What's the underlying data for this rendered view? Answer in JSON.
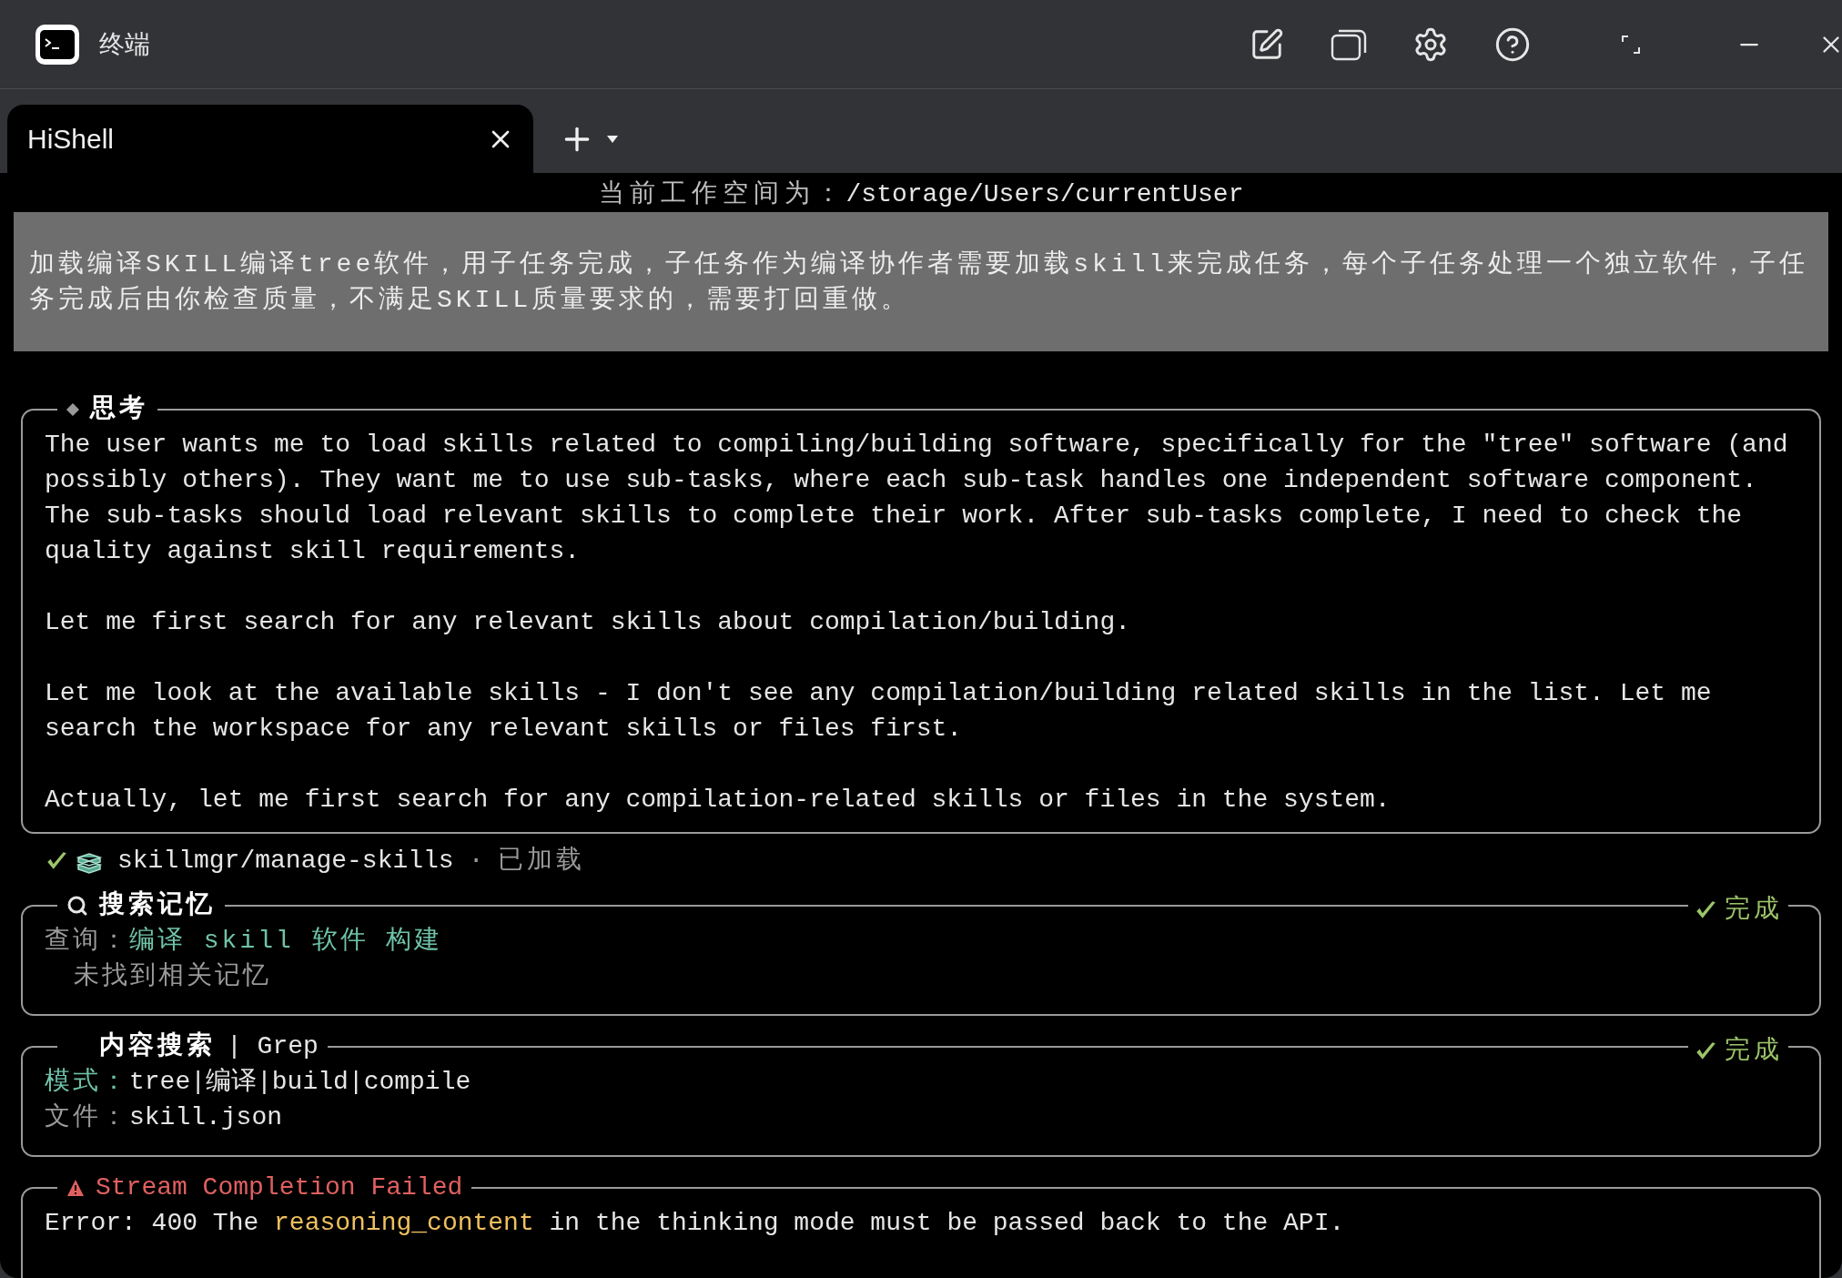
{
  "window": {
    "title": "终端"
  },
  "tabs": [
    {
      "label": "HiShell",
      "selected": true
    }
  ],
  "workspace": {
    "label": "当前工作空间为：",
    "path": "/storage/Users/currentUser"
  },
  "prompt": "加载编译SKILL编译tree软件，用子任务完成，子任务作为编译协作者需要加载skill来完成任务，每个子任务处理一个独立软件，子任务完成后由你检查质量，不满足SKILL质量要求的，需要打回重做。",
  "blocks": [
    {
      "kind": "thinking",
      "title": "思考",
      "paragraphs": [
        "The user wants me to load skills related to compiling/building software, specifically for the \"tree\" software (and\npossibly others). They want me to use sub-tasks, where each sub-task handles one independent software component.\nThe sub-tasks should load relevant skills to complete their work. After sub-tasks complete, I need to check the\nquality against skill requirements.",
        "Let me first search for any relevant skills about compilation/building.",
        "Let me look at the available skills - I don't see any compilation/building related skills in the list. Let me\nsearch the workspace for any relevant skills or files first.",
        "Actually, let me first search for any compilation-related skills or files in the system."
      ]
    },
    {
      "kind": "skill",
      "name": "skillmgr/manage-skills",
      "separator": "·",
      "status": "已加载"
    },
    {
      "kind": "memory_search",
      "title": "搜索记忆",
      "status": "完成",
      "lines": [
        {
          "kind": "query",
          "label": "查询：",
          "value": "编译 skill 软件 构建"
        },
        {
          "kind": "note",
          "value": "未找到相关记忆"
        }
      ]
    },
    {
      "kind": "content_search",
      "title": "内容搜索",
      "subtitle": "| Grep",
      "status": "完成",
      "lines": [
        {
          "kind": "pattern",
          "label": "模式：",
          "value": "tree|编译|build|compile"
        },
        {
          "kind": "file",
          "label": "文件：",
          "value": "skill.json"
        }
      ]
    },
    {
      "kind": "error",
      "title": "Stream Completion Failed",
      "message": [
        {
          "text": "Error: 400 The ",
          "highlight": false
        },
        {
          "text": "reasoning_content",
          "highlight": true
        },
        {
          "text": " in the thinking mode must be passed back to the API.",
          "highlight": false
        }
      ]
    }
  ]
}
